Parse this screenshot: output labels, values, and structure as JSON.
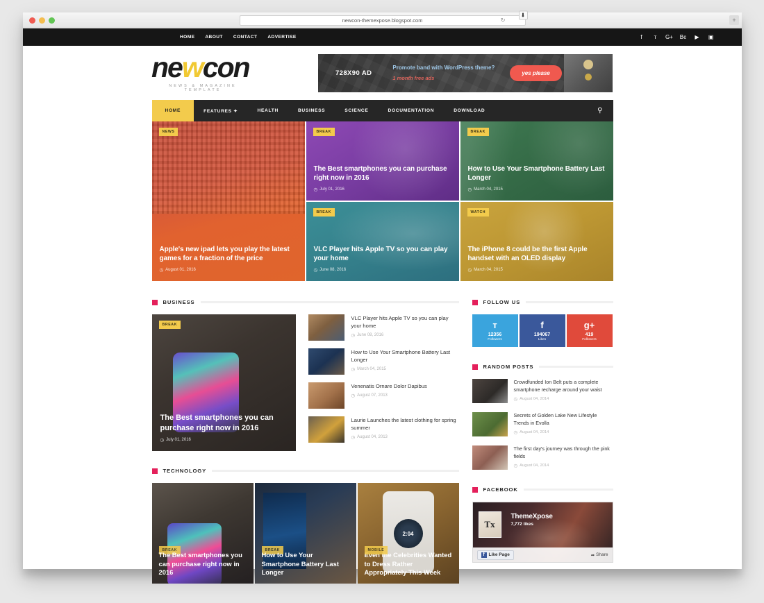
{
  "browser": {
    "url": "newcon-themexpose.blogspot.com",
    "reload_icon": "reload-icon",
    "download_icon": "download-icon",
    "newtab_label": "+"
  },
  "topbar": {
    "links": [
      {
        "label": "HOME"
      },
      {
        "label": "ABOUT"
      },
      {
        "label": "CONTACT"
      },
      {
        "label": "ADVERTISE"
      }
    ],
    "social": [
      {
        "name": "facebook-icon",
        "glyph": "f"
      },
      {
        "name": "twitter-icon",
        "glyph": "ᴛ"
      },
      {
        "name": "google-plus-icon",
        "glyph": "G+"
      },
      {
        "name": "behance-icon",
        "glyph": "Bє"
      },
      {
        "name": "youtube-icon",
        "glyph": "▶"
      },
      {
        "name": "instagram-icon",
        "glyph": "▣"
      }
    ]
  },
  "header": {
    "logo_pre": "ne",
    "logo_accent": "w",
    "logo_post": "con",
    "logo_tagline": "NEWS & MAGAZINE TEMPLATE",
    "ad": {
      "size_label": "728X90 AD",
      "headline": "Promote band with WordPress theme?",
      "subline": "1 month free ads",
      "button_label": "yes please"
    }
  },
  "mainnav": {
    "items": [
      {
        "label": "HOME",
        "active": true
      },
      {
        "label": "FEATURES ✦",
        "active": false
      },
      {
        "label": "HEALTH",
        "active": false
      },
      {
        "label": "BUSINESS",
        "active": false
      },
      {
        "label": "SCIENCE",
        "active": false
      },
      {
        "label": "DOCUMENTATION",
        "active": false
      },
      {
        "label": "DOWNLOAD",
        "active": false
      }
    ],
    "search_icon": "search-icon"
  },
  "featured": [
    {
      "badge": "NEWS",
      "title": "Apple's new ipad lets you play the latest games for a fraction of the price",
      "date": "August 01, 2016",
      "color": "#d9572f"
    },
    {
      "badge": "BREAK",
      "title": "The Best smartphones you can purchase right now in 2016",
      "date": "July 01, 2016",
      "color": "#7b3ea4"
    },
    {
      "badge": "BREAK",
      "title": "VLC Player hits Apple TV so you can play your home",
      "date": "June 08, 2016",
      "color": "#35818c"
    },
    {
      "badge": "BREAK",
      "title": "How to Use Your Smartphone Battery Last Longer",
      "date": "March 04, 2015",
      "color": "#356b47"
    },
    {
      "badge": "WATCH",
      "title": "The iPhone 8 could be the first Apple handset with an OLED display",
      "date": "March 04, 2015",
      "color": "#bd9733"
    }
  ],
  "business": {
    "section_title": "BUSINESS",
    "hero": {
      "badge": "BREAK",
      "title": "The Best smartphones you can purchase right now in 2016",
      "date": "July 01, 2016"
    },
    "items": [
      {
        "title": "VLC Player hits Apple TV so you can play your home",
        "date": "June 08, 2016"
      },
      {
        "title": "How to Use Your Smartphone Battery Last Longer",
        "date": "March 04, 2015"
      },
      {
        "title": "Venenatis Ornare Dolor Dapibus",
        "date": "August 07, 2013"
      },
      {
        "title": "Laurie Launches the latest clothing for spring summer",
        "date": "August 04, 2013"
      }
    ]
  },
  "technology": {
    "section_title": "TECHNOLOGY",
    "cards": [
      {
        "badge": "BREAK",
        "title": "The Best smartphones you can purchase right now in 2016"
      },
      {
        "badge": "BREAK",
        "title": "How to Use Your Smartphone Battery Last Longer"
      },
      {
        "badge": "MOBILE",
        "title": "Even the Celebrities Wanted to Dress Rather Appropriately This Week",
        "watch_time": "2:04"
      }
    ]
  },
  "sidebar": {
    "follow": {
      "section_title": "FOLLOW US",
      "boxes": [
        {
          "network": "twitter",
          "icon": "twitter-icon",
          "glyph": "ᴛ",
          "count": "12356",
          "label": "Followers",
          "color": "#3aa4dd"
        },
        {
          "network": "facebook",
          "icon": "facebook-icon",
          "glyph": "f",
          "count": "194067",
          "label": "Likes",
          "color": "#3a589b"
        },
        {
          "network": "google-plus",
          "icon": "google-plus-icon",
          "glyph": "g+",
          "count": "419",
          "label": "Followers",
          "color": "#e04a3b"
        }
      ]
    },
    "random": {
      "section_title": "RANDOM POSTS",
      "items": [
        {
          "title": "Crowdfunded Ion Belt puts a complete smartphone recharge around your waist",
          "date": "August 04, 2014"
        },
        {
          "title": "Secrets of Golden Lake New Lifestyle Trends in Evolla",
          "date": "August 04, 2014"
        },
        {
          "title": "The first day's journey was through the pink fields",
          "date": "August 04, 2014"
        }
      ]
    },
    "facebook": {
      "section_title": "FACEBOOK",
      "page_name": "ThemeXpose",
      "likes": "7,772 likes",
      "avatar_text": "Tx",
      "like_button": "Like Page",
      "share_button": "Share"
    }
  }
}
